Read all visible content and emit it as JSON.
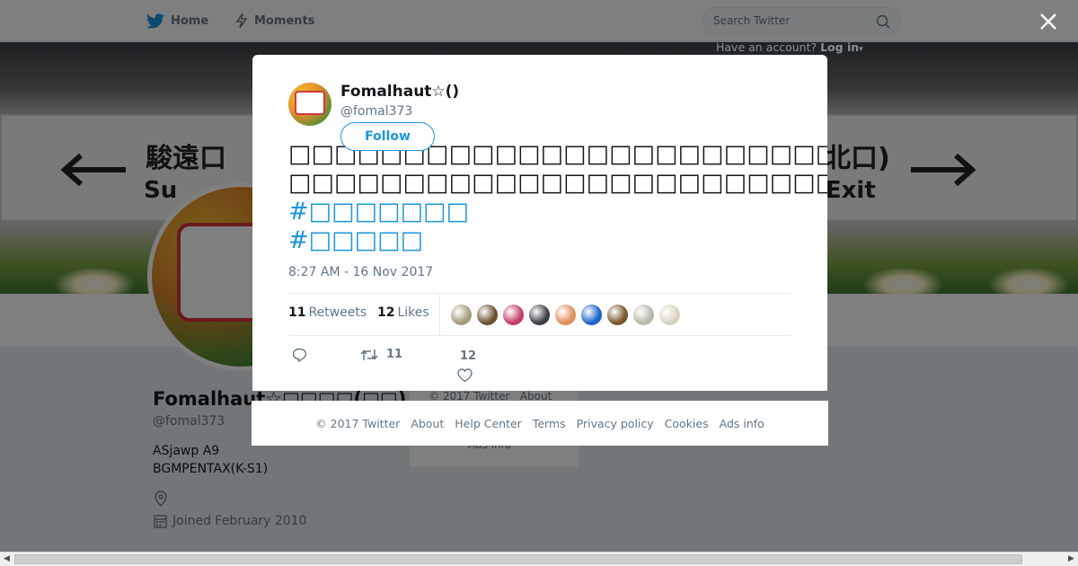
{
  "nav": {
    "home_label": "Home",
    "moments_label": "Moments",
    "search_placeholder": "Search Twitter",
    "have_account": "Have an account?",
    "login_label": "Log in"
  },
  "banner": {
    "left_sign": "駿遠口",
    "left_sign_sub": "Su",
    "right_sign": "北口)",
    "right_sign_sub": ")Exit"
  },
  "profile": {
    "name": "Fomalhaut☆□□□□(□□)",
    "handle": "@fomal373",
    "bio_line1": "ASjawp A9",
    "bio_line2": "BGMPENTAX(K-S1)",
    "joined": "Joined February 2010"
  },
  "side_card": {
    "copyright": "© 2017 Twitter",
    "about": "About",
    "ads_info": "Ads info"
  },
  "tweet": {
    "name": "Fomalhaut☆()",
    "handle": "@fomal373",
    "follow_label": "Follow",
    "text_line1": "□□□□□□□□□□□□□□□□□□□□□□□□□□□□□□□□□□□□□□□□□□□□□□□□□□□□□□□□□□□□□□□",
    "text_line2": "□□□□□□□□□□□□□□□□□□□□□□□□□□□□□□□□□□□□□□□",
    "hashtag1": "#□□□□□□□",
    "hashtag2": "#□□□□□",
    "timestamp": "8:27 AM - 16 Nov 2017",
    "retweets_count": "11",
    "retweets_label": "Retweets",
    "likes_count": "12",
    "likes_label": "Likes",
    "action_retweet_count": "11",
    "action_like_count": "12",
    "likers": [
      {
        "icon": "liker-avatar",
        "color": "#a39a7c"
      },
      {
        "icon": "liker-avatar",
        "color": "#6b4e2e"
      },
      {
        "icon": "liker-avatar",
        "color": "#c23c6c"
      },
      {
        "icon": "liker-avatar",
        "color": "#3b3b44"
      },
      {
        "icon": "liker-avatar",
        "color": "#e08d5a"
      },
      {
        "icon": "liker-avatar",
        "color": "#1a64c8"
      },
      {
        "icon": "liker-avatar",
        "color": "#7a5328"
      },
      {
        "icon": "liker-avatar",
        "color": "#b9b7a8"
      },
      {
        "icon": "liker-avatar",
        "color": "#d7d2c0"
      }
    ]
  },
  "footer": {
    "copyright": "© 2017 Twitter",
    "about": "About",
    "help_center": "Help Center",
    "terms": "Terms",
    "privacy": "Privacy policy",
    "cookies": "Cookies",
    "ads_info": "Ads info"
  },
  "colors": {
    "brand": "#1b95e0",
    "text": "#14171a",
    "muted": "#657786"
  }
}
